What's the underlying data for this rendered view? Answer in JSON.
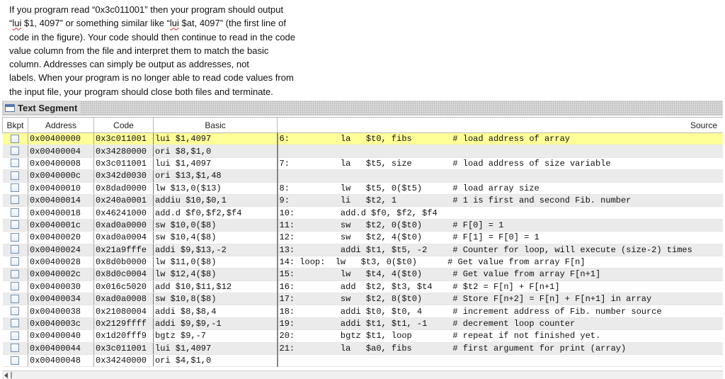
{
  "intro": {
    "l1": "If you program read “0x3c011001” then your program should output",
    "l2a": "“",
    "l2_lui1": "lui",
    "l2b": " $1, 4097” or something similar like “",
    "l2_lui2": "lui",
    "l2c": " $at, 4097” (the first line of",
    "l3": "code in the figure).  Your code should then continue to read in the code",
    "l4": "value column from the file and interpret them to match the basic",
    "l5": "column.  Addresses can simply be output as addresses, not",
    "l6": "labels.  When your program is no longer able to read code values from",
    "l7": "the input file, your program should close both files and terminate."
  },
  "panel": {
    "title": "Text Segment"
  },
  "columns": {
    "bkpt": "Bkpt",
    "address": "Address",
    "code": "Code",
    "basic": "Basic",
    "source": "Source"
  },
  "rows": [
    {
      "address": "0x00400000",
      "code": "0x3c011001",
      "basic": "lui $1,4097",
      "source": "6:          la   $t0, fibs        # load address of array"
    },
    {
      "address": "0x00400004",
      "code": "0x34280000",
      "basic": "ori $8,$1,0",
      "source": ""
    },
    {
      "address": "0x00400008",
      "code": "0x3c011001",
      "basic": "lui $1,4097",
      "source": "7:          la   $t5, size        # load address of size variable"
    },
    {
      "address": "0x0040000c",
      "code": "0x342d0030",
      "basic": "ori $13,$1,48",
      "source": ""
    },
    {
      "address": "0x00400010",
      "code": "0x8dad0000",
      "basic": "lw $13,0($13)",
      "source": "8:          lw   $t5, 0($t5)      # load array size"
    },
    {
      "address": "0x00400014",
      "code": "0x240a0001",
      "basic": "addiu $10,$0,1",
      "source": "9:          li   $t2, 1           # 1 is first and second Fib. number"
    },
    {
      "address": "0x00400018",
      "code": "0x46241000",
      "basic": "add.d $f0,$f2,$f4",
      "source": "10:         add.d $f0, $f2, $f4"
    },
    {
      "address": "0x0040001c",
      "code": "0xad0a0000",
      "basic": "sw $10,0($8)",
      "source": "11:         sw   $t2, 0($t0)      # F[0] = 1"
    },
    {
      "address": "0x00400020",
      "code": "0xad0a0004",
      "basic": "sw $10,4($8)",
      "source": "12:         sw   $t2, 4($t0)      # F[1] = F[0] = 1"
    },
    {
      "address": "0x00400024",
      "code": "0x21a9fffe",
      "basic": "addi $9,$13,-2",
      "source": "13:         addi $t1, $t5, -2     # Counter for loop, will execute (size-2) times"
    },
    {
      "address": "0x00400028",
      "code": "0x8d0b0000",
      "basic": "lw $11,0($8)",
      "source": "14: loop:  lw   $t3, 0($t0)      # Get value from array F[n]"
    },
    {
      "address": "0x0040002c",
      "code": "0x8d0c0004",
      "basic": "lw $12,4($8)",
      "source": "15:         lw   $t4, 4($t0)      # Get value from array F[n+1]"
    },
    {
      "address": "0x00400030",
      "code": "0x016c5020",
      "basic": "add $10,$11,$12",
      "source": "16:         add  $t2, $t3, $t4    # $t2 = F[n] + F[n+1]"
    },
    {
      "address": "0x00400034",
      "code": "0xad0a0008",
      "basic": "sw $10,8($8)",
      "source": "17:         sw   $t2, 8($t0)      # Store F[n+2] = F[n] + F[n+1] in array"
    },
    {
      "address": "0x00400038",
      "code": "0x21080004",
      "basic": "addi $8,$8,4",
      "source": "18:         addi $t0, $t0, 4      # increment address of Fib. number source"
    },
    {
      "address": "0x0040003c",
      "code": "0x2129ffff",
      "basic": "addi $9,$9,-1",
      "source": "19:         addi $t1, $t1, -1     # decrement loop counter"
    },
    {
      "address": "0x00400040",
      "code": "0x1d20fff9",
      "basic": "bgtz $9,-7",
      "source": "20:         bgtz $t1, loop        # repeat if not finished yet."
    },
    {
      "address": "0x00400044",
      "code": "0x3c011001",
      "basic": "lui $1,4097",
      "source": "21:         la   $a0, fibs        # first argument for print (array)"
    },
    {
      "address": "0x00400048",
      "code": "0x34240000",
      "basic": "ori $4,$1,0",
      "source": ""
    }
  ],
  "highlight_row": 0,
  "colors": {
    "highlight": "#ffff99",
    "stripe": "#ebebeb"
  },
  "icons": {
    "panel": "window-icon",
    "scroll_left": "scroll-left-arrow-icon"
  }
}
